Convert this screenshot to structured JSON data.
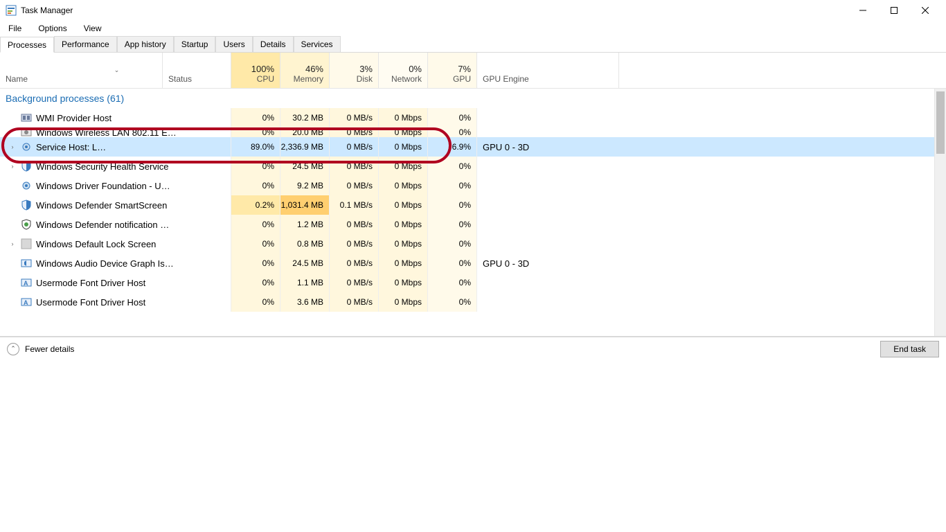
{
  "window": {
    "title": "Task Manager"
  },
  "menu": {
    "file": "File",
    "options": "Options",
    "view": "View"
  },
  "tabs": [
    {
      "label": "Processes",
      "active": true
    },
    {
      "label": "Performance",
      "active": false
    },
    {
      "label": "App history",
      "active": false
    },
    {
      "label": "Startup",
      "active": false
    },
    {
      "label": "Users",
      "active": false
    },
    {
      "label": "Details",
      "active": false
    },
    {
      "label": "Services",
      "active": false
    }
  ],
  "columns": {
    "name": "Name",
    "status": "Status",
    "cpu": {
      "value": "100%",
      "label": "CPU"
    },
    "mem": {
      "value": "46%",
      "label": "Memory"
    },
    "disk": {
      "value": "3%",
      "label": "Disk"
    },
    "net": {
      "value": "0%",
      "label": "Network"
    },
    "gpu": {
      "value": "7%",
      "label": "GPU"
    },
    "engine": "GPU Engine"
  },
  "group_header": "Background processes (61)",
  "rows": [
    {
      "exp": "",
      "icon": "wmi",
      "name": "WMI Provider Host",
      "cpu": "0%",
      "mem": "30.2 MB",
      "disk": "0 MB/s",
      "net": "0 Mbps",
      "gpu": "0%",
      "eng": "",
      "sel": false,
      "cpu_t": "tint-light",
      "mem_t": "tint-light",
      "disk_t": "tint-light",
      "net_t": "tint-light",
      "gpu_t": "tint-light2"
    },
    {
      "exp": "",
      "icon": "svc",
      "name": "Windows Wireless LAN 802.11 E…",
      "cpu": "0%",
      "mem": "20.0 MB",
      "disk": "0 MB/s",
      "net": "0 Mbps",
      "gpu": "0%",
      "eng": "",
      "sel": false,
      "cpu_t": "tint-light",
      "mem_t": "tint-light",
      "disk_t": "tint-light",
      "net_t": "tint-light",
      "gpu_t": "tint-light2",
      "obscured": true
    },
    {
      "exp": "›",
      "icon": "gear",
      "name": "Service Host: L…",
      "cpu": "89.0%",
      "mem": "2,336.9 MB",
      "disk": "0 MB/s",
      "net": "0 Mbps",
      "gpu": "6.9%",
      "eng": "GPU 0 - 3D",
      "sel": true,
      "cpu_t": "tint-vhigh",
      "mem_t": "tint-vhigh",
      "disk_t": "tint-light",
      "net_t": "tint-light",
      "gpu_t": "tint-light"
    },
    {
      "exp": "›",
      "icon": "shield",
      "name": "Windows Security Health Service",
      "cpu": "0%",
      "mem": "24.5 MB",
      "disk": "0 MB/s",
      "net": "0 Mbps",
      "gpu": "0%",
      "eng": "",
      "sel": false,
      "cpu_t": "tint-light",
      "mem_t": "tint-light",
      "disk_t": "tint-light",
      "net_t": "tint-light",
      "gpu_t": "tint-light2"
    },
    {
      "exp": "",
      "icon": "gear",
      "name": "Windows Driver Foundation - U…",
      "cpu": "0%",
      "mem": "9.2 MB",
      "disk": "0 MB/s",
      "net": "0 Mbps",
      "gpu": "0%",
      "eng": "",
      "sel": false,
      "cpu_t": "tint-light",
      "mem_t": "tint-light",
      "disk_t": "tint-light",
      "net_t": "tint-light",
      "gpu_t": "tint-light2"
    },
    {
      "exp": "",
      "icon": "shield",
      "name": "Windows Defender SmartScreen",
      "cpu": "0.2%",
      "mem": "1,031.4 MB",
      "disk": "0.1 MB/s",
      "net": "0 Mbps",
      "gpu": "0%",
      "eng": "",
      "sel": false,
      "cpu_t": "tint-med",
      "mem_t": "tint-high",
      "disk_t": "tint-light",
      "net_t": "tint-light",
      "gpu_t": "tint-light2"
    },
    {
      "exp": "",
      "icon": "shield2",
      "name": "Windows Defender notification …",
      "cpu": "0%",
      "mem": "1.2 MB",
      "disk": "0 MB/s",
      "net": "0 Mbps",
      "gpu": "0%",
      "eng": "",
      "sel": false,
      "cpu_t": "tint-light",
      "mem_t": "tint-light",
      "disk_t": "tint-light",
      "net_t": "tint-light",
      "gpu_t": "tint-light2"
    },
    {
      "exp": "›",
      "icon": "blank",
      "name": "Windows Default Lock Screen",
      "cpu": "0%",
      "mem": "0.8 MB",
      "disk": "0 MB/s",
      "net": "0 Mbps",
      "gpu": "0%",
      "eng": "",
      "sel": false,
      "cpu_t": "tint-light",
      "mem_t": "tint-light",
      "disk_t": "tint-light",
      "net_t": "tint-light",
      "gpu_t": "tint-light2"
    },
    {
      "exp": "",
      "icon": "audio",
      "name": "Windows Audio Device Graph Is…",
      "cpu": "0%",
      "mem": "24.5 MB",
      "disk": "0 MB/s",
      "net": "0 Mbps",
      "gpu": "0%",
      "eng": "GPU 0 - 3D",
      "sel": false,
      "cpu_t": "tint-light",
      "mem_t": "tint-light",
      "disk_t": "tint-light",
      "net_t": "tint-light",
      "gpu_t": "tint-light2"
    },
    {
      "exp": "",
      "icon": "font",
      "name": "Usermode Font Driver Host",
      "cpu": "0%",
      "mem": "1.1 MB",
      "disk": "0 MB/s",
      "net": "0 Mbps",
      "gpu": "0%",
      "eng": "",
      "sel": false,
      "cpu_t": "tint-light",
      "mem_t": "tint-light",
      "disk_t": "tint-light",
      "net_t": "tint-light",
      "gpu_t": "tint-light2"
    },
    {
      "exp": "",
      "icon": "font",
      "name": "Usermode Font Driver Host",
      "cpu": "0%",
      "mem": "3.6 MB",
      "disk": "0 MB/s",
      "net": "0 Mbps",
      "gpu": "0%",
      "eng": "",
      "sel": false,
      "cpu_t": "tint-light",
      "mem_t": "tint-light",
      "disk_t": "tint-light",
      "net_t": "tint-light",
      "gpu_t": "tint-light2"
    }
  ],
  "footer": {
    "fewer": "Fewer details",
    "end_task": "End task"
  },
  "annotation": {
    "highlight_row_index": 2
  }
}
